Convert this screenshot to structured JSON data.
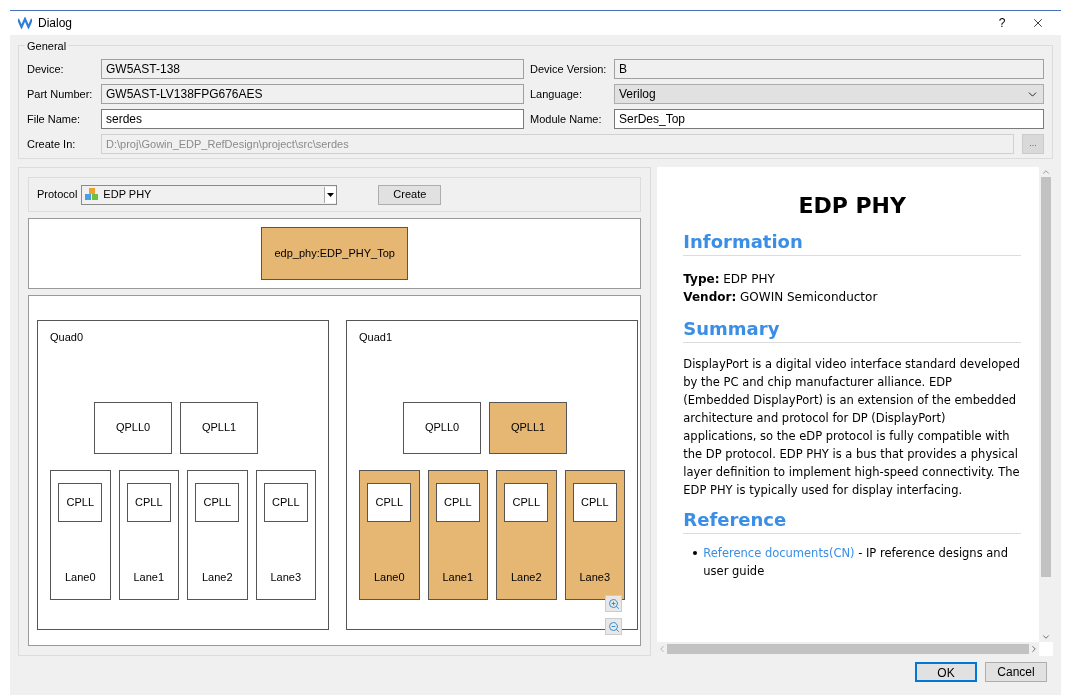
{
  "window": {
    "title": "Dialog",
    "help": "?"
  },
  "general": {
    "title": "General",
    "fields": [
      {
        "label": "Device:",
        "value": "GW5AST-138",
        "kind": "readonly"
      },
      {
        "label": "Device Version:",
        "value": "B",
        "kind": "readonly"
      },
      {
        "label": "Part Number:",
        "value": "GW5AST-LV138FPG676AES",
        "kind": "readonly"
      },
      {
        "label": "Language:",
        "value": "Verilog",
        "kind": "dropdown"
      },
      {
        "label": "File Name:",
        "value": "serdes",
        "kind": "text"
      },
      {
        "label": "Module Name:",
        "value": "SerDes_Top",
        "kind": "text"
      }
    ],
    "create_in": {
      "label": "Create In:",
      "value": "D:\\proj\\Gowin_EDP_RefDesign\\project\\src\\serdes",
      "disabled": true,
      "browse": "..."
    }
  },
  "protocol": {
    "label": "Protocol",
    "value": "EDP PHY",
    "create": "Create"
  },
  "top_module": {
    "label": "edp_phy:EDP_PHY_Top",
    "selected": true
  },
  "quads": [
    {
      "name": "Quad0",
      "qplls": [
        {
          "name": "QPLL0",
          "selected": false
        },
        {
          "name": "QPLL1",
          "selected": false
        }
      ],
      "lanes": [
        {
          "name": "Lane0",
          "cpll": "CPLL",
          "selected": false
        },
        {
          "name": "Lane1",
          "cpll": "CPLL",
          "selected": false
        },
        {
          "name": "Lane2",
          "cpll": "CPLL",
          "selected": false
        },
        {
          "name": "Lane3",
          "cpll": "CPLL",
          "selected": false
        }
      ]
    },
    {
      "name": "Quad1",
      "qplls": [
        {
          "name": "QPLL0",
          "selected": false
        },
        {
          "name": "QPLL1",
          "selected": true
        }
      ],
      "lanes": [
        {
          "name": "Lane0",
          "cpll": "CPLL",
          "selected": true
        },
        {
          "name": "Lane1",
          "cpll": "CPLL",
          "selected": true
        },
        {
          "name": "Lane2",
          "cpll": "CPLL",
          "selected": true
        },
        {
          "name": "Lane3",
          "cpll": "CPLL",
          "selected": true
        }
      ]
    }
  ],
  "info": {
    "title": "EDP PHY",
    "information": {
      "heading": "Information",
      "items": [
        {
          "key": "Type:",
          "value": "EDP PHY"
        },
        {
          "key": "Vendor:",
          "value": "GOWIN Semiconductor"
        }
      ]
    },
    "summary": {
      "heading": "Summary",
      "text": "DisplayPort is a digital video interface standard developed by the PC and chip manufacturer alliance. EDP (Embedded DisplayPort) is an extension of the embedded architecture and protocol for DP (DisplayPort) applications, so the eDP protocol is fully compatible with the DP protocol. EDP PHY is a bus that provides a physical layer definition to implement high-speed connectivity. The EDP PHY is typically used for display interfacing."
    },
    "reference": {
      "heading": "Reference",
      "items": [
        {
          "link": "Reference documents(CN)",
          "text": " - IP reference designs and user guide"
        }
      ]
    }
  },
  "buttons": [
    {
      "label": "OK",
      "default": true
    },
    {
      "label": "Cancel",
      "default": false
    }
  ]
}
